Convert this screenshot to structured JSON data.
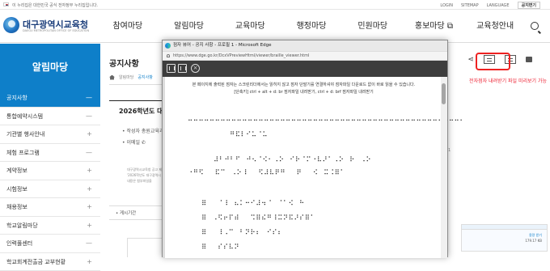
{
  "topbar": {
    "gov_notice": "이 누리집은 대한민국 공식 전자정부 누리집입니다.",
    "login": "LOGIN",
    "sitemap": "SITEMAP",
    "language": "LANGUAGE",
    "chat": "공지면기"
  },
  "header": {
    "logo_title": "대구광역시교육청",
    "logo_sub": "DAEGU METROPOLITAN OFFICE OF EDUCATION",
    "nav": [
      "참여마당",
      "알림마당",
      "교육마당",
      "행정마당",
      "민원마당",
      "홍보마당 ⧉",
      "교육청안내"
    ]
  },
  "sidebar": {
    "title": "알림마당",
    "items": [
      {
        "label": "공지사항",
        "mark": "—"
      },
      {
        "label": "통합예약시스템",
        "mark": "—"
      },
      {
        "label": "기관별 행사안내",
        "mark": "+"
      },
      {
        "label": "체험 프로그램",
        "mark": "—"
      },
      {
        "label": "계약정보",
        "mark": "+"
      },
      {
        "label": "시험정보",
        "mark": "+"
      },
      {
        "label": "채용정보",
        "mark": "+"
      },
      {
        "label": "학교알림마당",
        "mark": "+"
      },
      {
        "label": "인력풀센터",
        "mark": "—"
      },
      {
        "label": "학교회계전출금 교부현황",
        "mark": "+"
      }
    ]
  },
  "main": {
    "page_title": "공지사항",
    "breadcrumb": [
      "알림마당",
      "공지사항"
    ],
    "braille_note": "전자점자 내려받기 파일 미리보기 가능",
    "article_title": "2026학년도 대구",
    "author": "• 작성자  총원교육과",
    "email": "• 이메일  ✆",
    "body_text": "대구광역시교육청 공고 제 '2026학년도 대구광역시 자세한 내용은 첨부파일을",
    "attach_label": "• 게시기간",
    "right_info": "1",
    "file_header": "용량 받기",
    "file_size": "179.17 KB"
  },
  "popup": {
    "title": "점자 뷰어 - 공지 사항 - 프로필 1 - Microsoft Edge",
    "url": "https://www.dge.go.kr/DcxVPreviewHtml/viewer/braille_viewer.html",
    "note1": "본 페이지에 출력된 점자는 스크린리더에서는 읽히지 않고 점자 단말기를 연결하셔야 점자파일 다운로드 없이 바로 읽을 수 있습니다.",
    "note2": "[단축키] ctrl + alt + d: br 점자파일 내려받기, ctrl + d: brf 점자파일 내려받기",
    "braille_lines": [
      "⠒⠒⠒⠒⠒⠒⠒⠒⠒⠒⠒⠒⠒⠒⠒⠒⠒⠒⠒⠒⠒⠒⠒⠒⠒⠒⠒⠒⠒⠒⠒⠒⠒⠒⠒⠒⠒⠒⠒⠒⠒⠒⠒⠒⠒⠒⠒⠒⠒⠒⠂",
      "⠛⠯⠇⠊⠥⠈⠥",
      "⠼⠃⠚⠃⠋⠀⠚⠢⠈⠪⠂⠠⠕⠀⠊⠗⠈⠍⠐⠧⠜⠁⠠⠕⠀⠗⠀⠠⠕",
      "⠐⠛⠫⠀⠀⠯⠉⠀⠠⠕⠸⠀⠀⠫⠼⠧⠟⠛⠀⠀⠟⠀⠀⠪⠀⠭⠨⠿⠁",
      "⠿⠀⠀⠈⠸⠀⠦⠅⠒⠊⠼⠲⠈⠀⠈⠁⠪⠀⠓",
      "⠿⠀⠠⠫⠖⠏⠾⠀⠀⠩⠿⠮⠛⠸⠭⠝⠯⠜⠎⠿⠁",
      "⠿⠀⠀⠸⠠⠉⠀⠃⠝⠗⠆⠀⠊⠎⠆",
      "⠿⠀⠀⠎⠎⠧⠝"
    ]
  }
}
